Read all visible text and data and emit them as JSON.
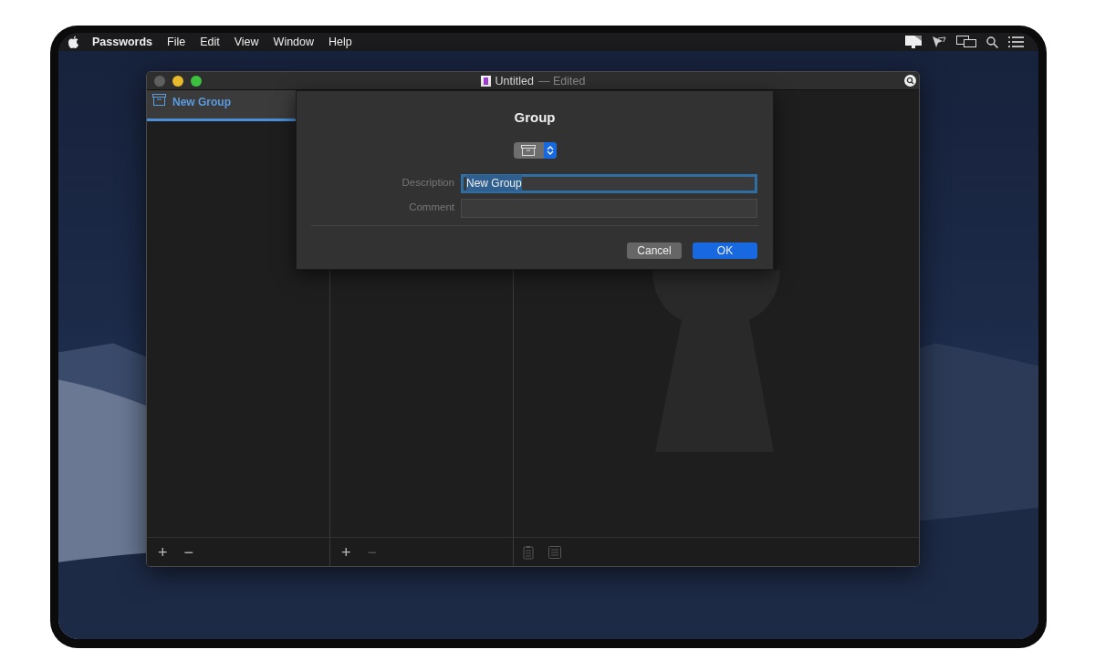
{
  "menu_bar": {
    "app": "Passwords",
    "menus": [
      "File",
      "Edit",
      "View",
      "Window",
      "Help"
    ]
  },
  "window": {
    "title": "Untitled",
    "status": "— Edited"
  },
  "sidebar": {
    "items": [
      {
        "label": "New Group",
        "selected": true
      }
    ]
  },
  "bottom_bars": [
    {
      "buttons": [
        {
          "label": "+",
          "disabled": false
        },
        {
          "label": "−",
          "disabled": false
        }
      ]
    },
    {
      "buttons": [
        {
          "label": "+",
          "disabled": false
        },
        {
          "label": "−",
          "disabled": true
        }
      ]
    }
  ],
  "dialog": {
    "title": "Group",
    "fields": [
      {
        "label": "Description",
        "value": "New Group",
        "focused": true
      },
      {
        "label": "Comment",
        "focused": false
      }
    ],
    "buttons": [
      {
        "label": "Cancel",
        "default": false
      },
      {
        "label": "OK",
        "default": true
      }
    ]
  }
}
